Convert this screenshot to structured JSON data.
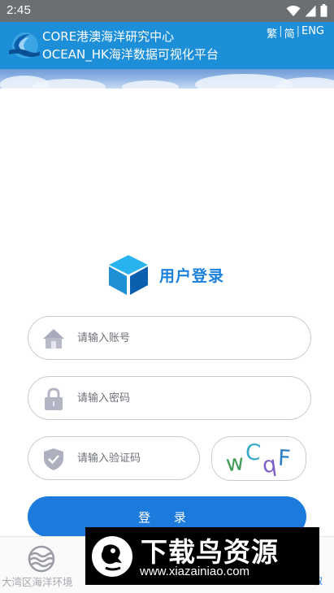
{
  "status_bar": {
    "time": "2:45",
    "icons": [
      "wifi-icon",
      "signal-icon",
      "battery-icon"
    ]
  },
  "header": {
    "title_line1": "CORE港澳海洋研究中心",
    "title_line2": "OCEAN_HK海洋数据可视化平台",
    "lang": [
      "繁",
      "简",
      "ENG"
    ],
    "lang_separator": "|",
    "background": "#1d8fd8"
  },
  "login": {
    "heading": "用户登录",
    "username_placeholder": "请输入账号",
    "password_placeholder": "请输入密码",
    "captcha_placeholder": "请输入验证码",
    "captcha_chars": [
      {
        "char": "w",
        "color": "#3f9b54"
      },
      {
        "char": "C",
        "color": "#3aa8c9"
      },
      {
        "char": "q",
        "color": "#7c5fc8"
      },
      {
        "char": "F",
        "color": "#2f7fc6"
      }
    ],
    "submit_label": "登 录",
    "accent": "#1d7bdd"
  },
  "bottom_nav": {
    "items": [
      {
        "label": "大湾区海洋环境",
        "icon": "waves-icon"
      }
    ],
    "partial_label": "叔"
  },
  "watermark": {
    "title": "下载鸟资源",
    "url": "www.xiazainiao.com"
  }
}
